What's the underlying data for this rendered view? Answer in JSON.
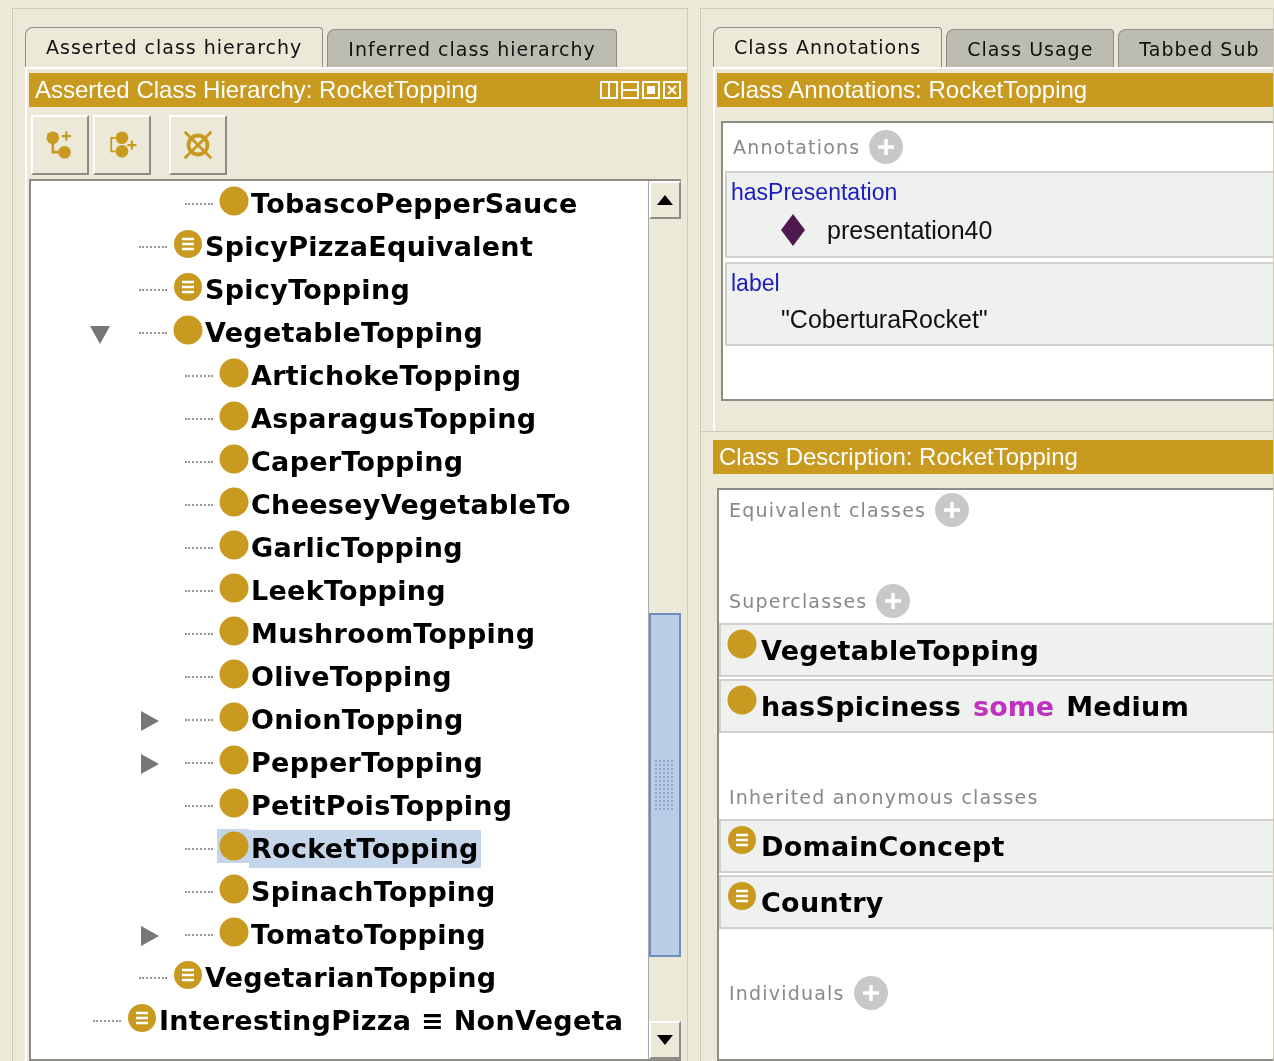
{
  "left_panel": {
    "tabs": [
      {
        "label": "Asserted class hierarchy",
        "selected": true
      },
      {
        "label": "Inferred class hierarchy",
        "selected": false
      }
    ],
    "view_title": "Asserted Class Hierarchy: RocketTopping",
    "tree": [
      {
        "children": [
          {
            "children": [
              {
                "name": "TobascoPepperSauce",
                "kind": "primitive",
                "selected": false
              }
            ]
          },
          {
            "name": "SpicyPizzaEquivalent",
            "kind": "defined",
            "selected": false
          },
          {
            "name": "SpicyTopping",
            "kind": "defined",
            "selected": false
          },
          {
            "name": "VegetableTopping",
            "kind": "primitive",
            "selected": false,
            "expanded": true,
            "children": [
              {
                "name": "ArtichokeTopping",
                "kind": "primitive",
                "selected": false
              },
              {
                "name": "AsparagusTopping",
                "kind": "primitive",
                "selected": false
              },
              {
                "name": "CaperTopping",
                "kind": "primitive",
                "selected": false
              },
              {
                "name": "CheeseyVegetableTo",
                "kind": "primitive",
                "selected": false
              },
              {
                "name": "GarlicTopping",
                "kind": "primitive",
                "selected": false
              },
              {
                "name": "LeekTopping",
                "kind": "primitive",
                "selected": false
              },
              {
                "name": "MushroomTopping",
                "kind": "primitive",
                "selected": false
              },
              {
                "name": "OliveTopping",
                "kind": "primitive",
                "selected": false
              },
              {
                "name": "OnionTopping",
                "kind": "primitive",
                "selected": false,
                "expanded": false
              },
              {
                "name": "PepperTopping",
                "kind": "primitive",
                "selected": false,
                "expanded": false
              },
              {
                "name": "PetitPoisTopping",
                "kind": "primitive",
                "selected": false
              },
              {
                "name": "RocketTopping",
                "kind": "primitive",
                "selected": true
              },
              {
                "name": "SpinachTopping",
                "kind": "primitive",
                "selected": false
              },
              {
                "name": "TomatoTopping",
                "kind": "primitive",
                "selected": false,
                "expanded": false
              }
            ]
          },
          {
            "name": "VegetarianTopping",
            "kind": "defined",
            "selected": false
          }
        ]
      },
      {
        "name": "InterestingPizza ≡ NonVegeta",
        "kind": "defined",
        "selected": false
      }
    ]
  },
  "right_panel": {
    "tabs": [
      {
        "label": "Class Annotations",
        "selected": true
      },
      {
        "label": "Class Usage",
        "selected": false
      },
      {
        "label": "Tabbed Sub",
        "selected": false
      }
    ],
    "annotations_view": {
      "title": "Class Annotations: RocketTopping",
      "heading": "Annotations",
      "annotations": [
        {
          "property": "hasPresentation",
          "value": "presentation40",
          "kind": "individual"
        },
        {
          "property": "label",
          "value": "\"CoberturaRocket\"",
          "kind": "literal"
        }
      ]
    },
    "description_view": {
      "title": "Class Description: RocketTopping",
      "sections": [
        {
          "heading": "Equivalent classes",
          "add_button": true
        },
        {
          "heading": "Superclasses",
          "add_button": true,
          "items": [
            {
              "kind": "primitive",
              "parts": [
                {
                  "text": "VegetableTopping",
                  "kind": "entity"
                }
              ]
            },
            {
              "kind": "primitive",
              "parts": [
                {
                  "text": "hasSpiciness",
                  "kind": "entity"
                },
                {
                  "text": "some",
                  "kind": "keyword"
                },
                {
                  "text": "Medium",
                  "kind": "entity"
                }
              ]
            }
          ]
        },
        {
          "heading": "Inherited anonymous classes",
          "add_button": false,
          "items": [
            {
              "kind": "defined",
              "parts": [
                {
                  "text": "DomainConcept",
                  "kind": "entity"
                }
              ]
            },
            {
              "kind": "defined",
              "parts": [
                {
                  "text": "Country",
                  "kind": "entity"
                }
              ]
            }
          ]
        },
        {
          "heading": "Individuals",
          "add_button": true
        }
      ]
    }
  }
}
